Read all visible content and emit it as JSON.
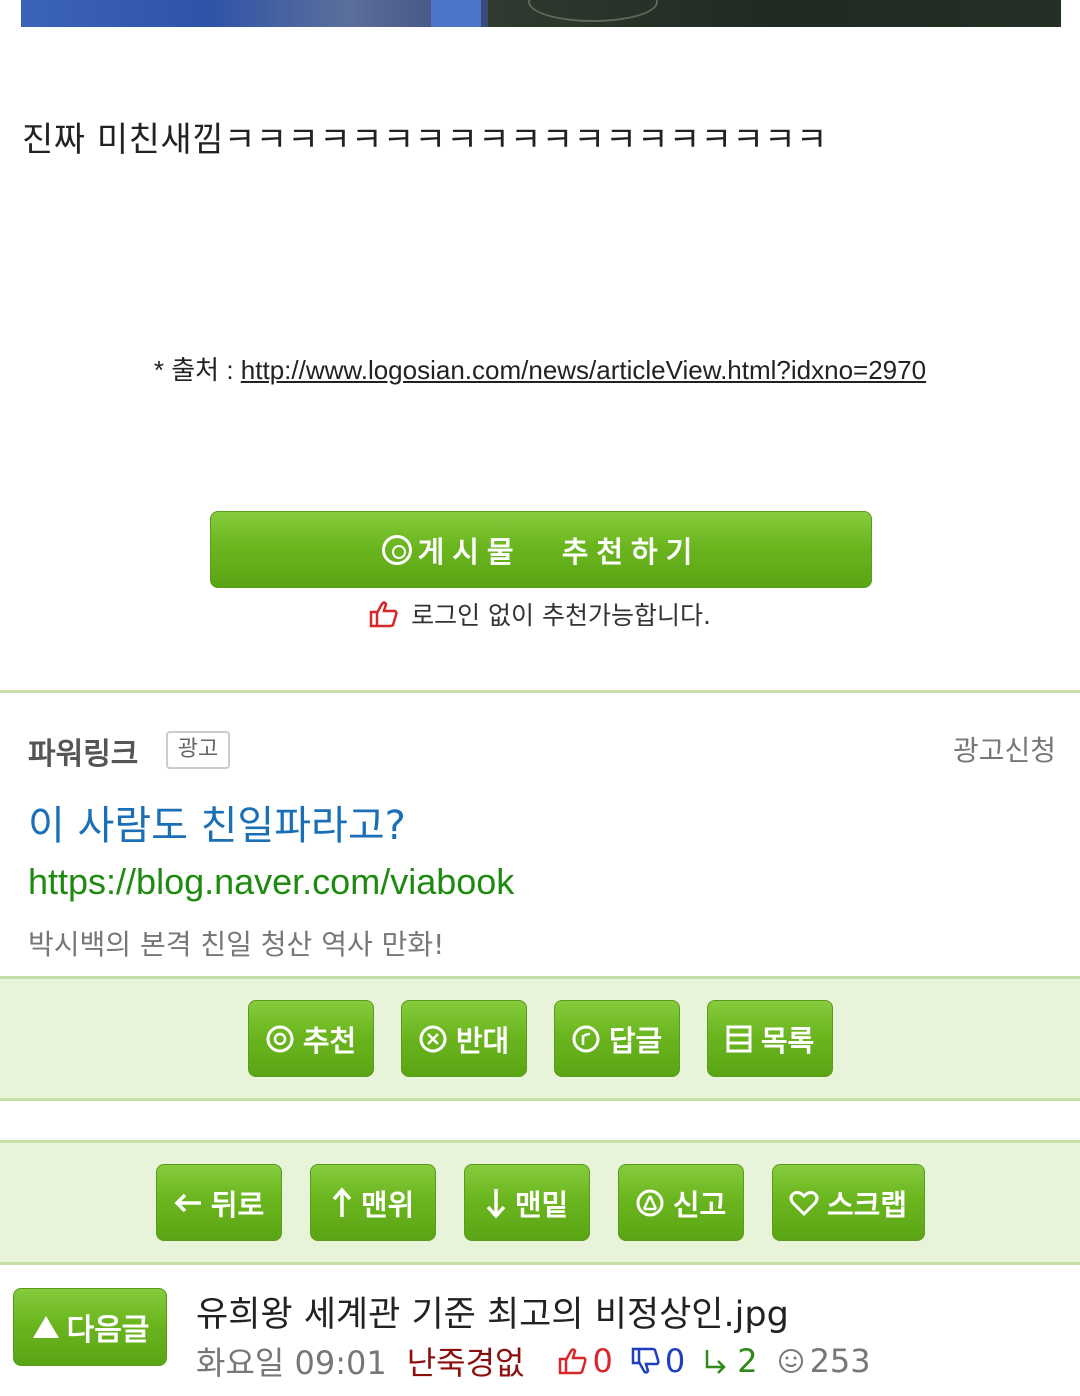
{
  "post": {
    "body_text": "진짜 미친새낌ㅋㅋㅋㅋㅋㅋㅋㅋㅋㅋㅋㅋㅋㅋㅋㅋㅋㅋㅋ",
    "source_prefix": "* 출처 : ",
    "source_url": "http://www.logosian.com/news/articleView.html?idxno=2970"
  },
  "recommend": {
    "button_label": "게시물 추천하기",
    "note": "로그인 없이 추천가능합니다."
  },
  "ad": {
    "powerlink_label": "파워링크",
    "badge": "광고",
    "apply_label": "광고신청",
    "title": "이 사람도 친일파라고?",
    "url": "https://blog.naver.com/viabook",
    "description": "박시백의 본격 친일 청산 역사 만화!"
  },
  "actions_row1": [
    {
      "label": "추천",
      "icon": "recommend-icon"
    },
    {
      "label": "반대",
      "icon": "oppose-icon"
    },
    {
      "label": "답글",
      "icon": "reply-icon"
    },
    {
      "label": "목록",
      "icon": "list-icon"
    }
  ],
  "actions_row2": [
    {
      "label": "뒤로",
      "icon": "arrow-left-icon"
    },
    {
      "label": "맨위",
      "icon": "arrow-up-icon"
    },
    {
      "label": "맨밑",
      "icon": "arrow-down-icon"
    },
    {
      "label": "신고",
      "icon": "report-icon"
    },
    {
      "label": "스크랩",
      "icon": "heart-icon"
    }
  ],
  "next_post": {
    "button_label": "다음글",
    "title": "유희왕 세계관 기준 최고의 비정상인.jpg",
    "time": "화요일 09:01",
    "author": "난죽경없",
    "up_count": "0",
    "down_count": "0",
    "reply_count": "2",
    "view_count": "253"
  }
}
